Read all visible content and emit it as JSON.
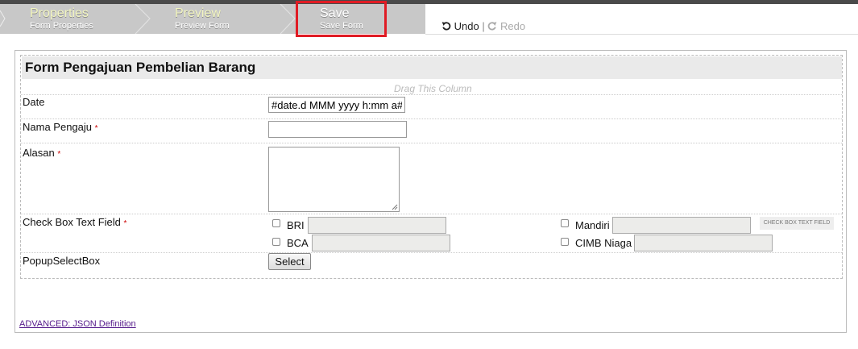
{
  "wizard": {
    "steps": [
      {
        "title": "Properties",
        "subtitle": "Form Properties"
      },
      {
        "title": "Preview",
        "subtitle": "Preview Form"
      },
      {
        "title": "Save",
        "subtitle": "Save Form"
      }
    ]
  },
  "history": {
    "undo_label": "Undo",
    "separator": "|",
    "redo_label": "Redo"
  },
  "form": {
    "title": "Form Pengajuan Pembelian Barang",
    "drag_hint": "Drag This Column",
    "fields": {
      "date": {
        "label": "Date",
        "value": "#date.d MMM yyyy h:mm a#"
      },
      "nama_pengaju": {
        "label": "Nama Pengaju",
        "required_mark": "*",
        "value": ""
      },
      "alasan": {
        "label": "Alasan",
        "required_mark": "*",
        "value": ""
      },
      "checkbox_text_field": {
        "label": "Check Box Text Field",
        "required_mark": "*",
        "options": [
          "BRI",
          "Mandiri",
          "BCA",
          "CIMB Niaga"
        ],
        "badge": "CHECK BOX TEXT FIELD"
      },
      "popup_select": {
        "label": "PopupSelectBox",
        "button_label": "Select"
      }
    }
  },
  "advanced_link": "ADVANCED: JSON Definition",
  "colors": {
    "highlight": "#e01b24",
    "step_bar": "#c8c8c8",
    "required": "#cc0000",
    "link": "#551a8b"
  }
}
